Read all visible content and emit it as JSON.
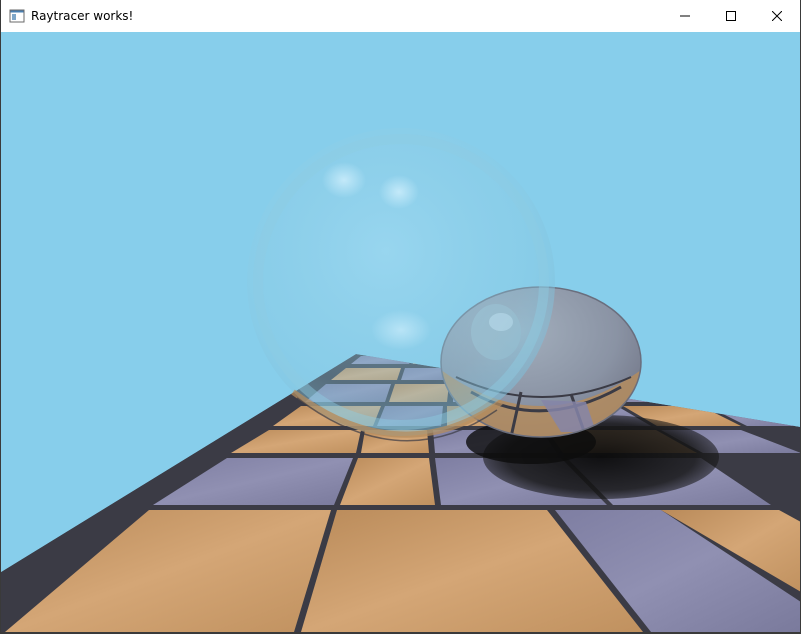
{
  "window": {
    "title": "Raytracer works!",
    "app_icon": "app-window-icon",
    "controls": [
      {
        "name": "minimize",
        "icon": "minimize-icon"
      },
      {
        "name": "maximize",
        "icon": "maximize-icon"
      },
      {
        "name": "close",
        "icon": "close-icon"
      }
    ]
  },
  "scene": {
    "sky_color": "#87ceeb",
    "tile_colors": [
      "#c89c69",
      "#8585a8"
    ],
    "grout_color": "#3b3b45",
    "glass_sphere_tint": "#9dd3e8",
    "mirror_sphere_tint": "#8c8c9e",
    "shadow_color": "#151515"
  }
}
